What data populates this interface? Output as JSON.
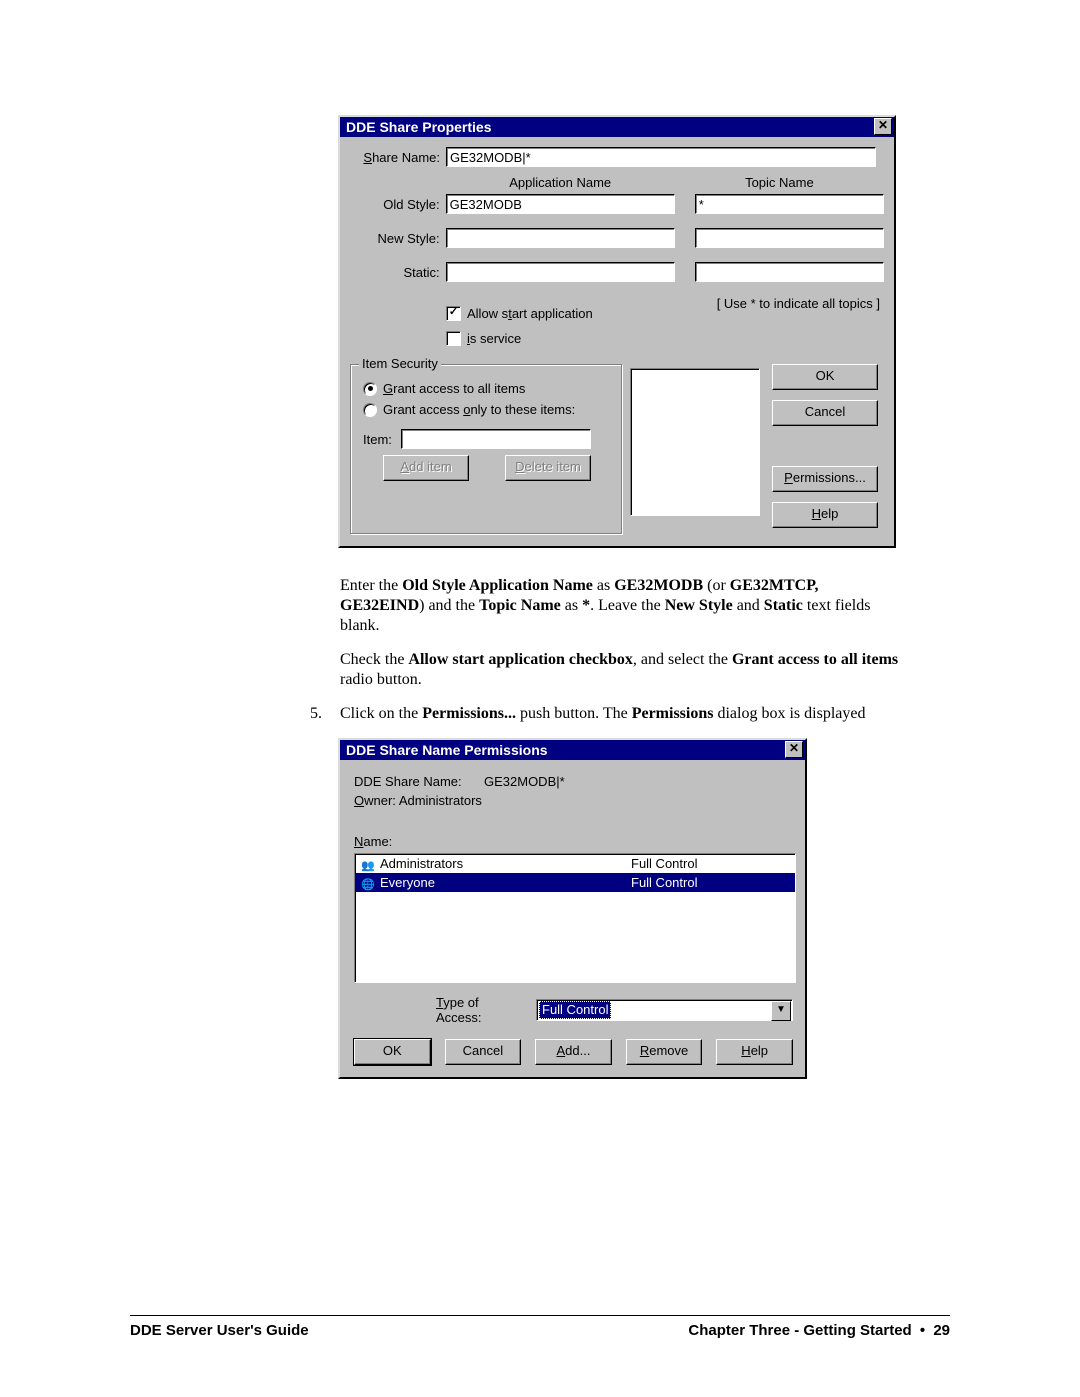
{
  "dialog1": {
    "title": "DDE Share Properties",
    "labels": {
      "share_name_pre": "S",
      "share_name_post": "hare Name:",
      "application_name": "Application Name",
      "topic_name": "Topic Name",
      "old_style": "Old Style:",
      "new_style": "New Style:",
      "static": "Static:"
    },
    "values": {
      "share_name": "GE32MODB|*",
      "old_app": "GE32MODB",
      "old_topic": "*",
      "new_app": "",
      "new_topic": "",
      "static_app": "",
      "static_topic": ""
    },
    "checkboxes": {
      "allow_start_label_pre": "Allow s",
      "allow_start_label_u": "t",
      "allow_start_label_post": "art application",
      "allow_start_checked": "✓",
      "is_service_label_pre": "i",
      "is_service_label_post": "s service"
    },
    "hint": "[ Use * to indicate all topics ]",
    "item_security": {
      "legend": "Item Security",
      "grant_all_pre": "G",
      "grant_all_post": "rant access to all items",
      "grant_only_pre_1": "Grant access ",
      "grant_only_u": "o",
      "grant_only_post": "nly to these items:",
      "item_label": "Item:",
      "add_item_u": "A",
      "add_item_post": "dd item",
      "delete_item_u": "D",
      "delete_item_post": "elete item"
    },
    "buttons": {
      "ok": "OK",
      "cancel": "Cancel",
      "permissions_u": "P",
      "permissions_post": "ermissions...",
      "help_u": "H",
      "help_post": "elp"
    }
  },
  "instructions": {
    "p1_a": "Enter the ",
    "p1_b1": "Old Style Application Name",
    "p1_c": " as ",
    "p1_b2": "GE32MODB",
    "p1_d": " (or ",
    "p1_b3": "GE32MTCP, GE32EIND",
    "p1_e": ") and the ",
    "p1_b4": "Topic Name",
    "p1_f": " as ",
    "p1_b5": "*",
    "p1_g": ". Leave the ",
    "p1_b6": "New Style",
    "p1_h": " and ",
    "p1_b7": "Static",
    "p1_i": " text fields blank.",
    "p2_a": "Check the ",
    "p2_b1": "Allow start application checkbox",
    "p2_b": ", and select the ",
    "p2_b2": "Grant access to all items",
    "p2_c": " radio button.",
    "step5_num": "5.",
    "step5_a": "Click on the ",
    "step5_b1": "Permissions...",
    "step5_b": " push button. The ",
    "step5_b2": "Permissions",
    "step5_c": " dialog box is displayed"
  },
  "dialog2": {
    "title": "DDE Share Name Permissions",
    "labels": {
      "dde_share_name": "DDE Share Name:",
      "dde_share_value": "GE32MODB|*",
      "owner_u": "O",
      "owner_post": "wner:",
      "owner_value": "  Administrators",
      "name_u": "N",
      "name_post": "ame:",
      "type_access_u": "T",
      "type_access_post": "ype of Access:"
    },
    "list": {
      "row1_name": "Administrators",
      "row1_perm": "Full Control",
      "row2_name": "Everyone",
      "row2_perm": "Full Control"
    },
    "type_access_value": "Full Control",
    "buttons": {
      "ok": "OK",
      "cancel": "Cancel",
      "add_u": "A",
      "add_post": "dd...",
      "remove_u": "R",
      "remove_post": "emove",
      "help_u": "H",
      "help_post": "elp"
    }
  },
  "footer": {
    "left": "DDE Server User's Guide",
    "right_pre": "Chapter Three - Getting Started",
    "right_dot": "  •  ",
    "right_page": "29"
  }
}
